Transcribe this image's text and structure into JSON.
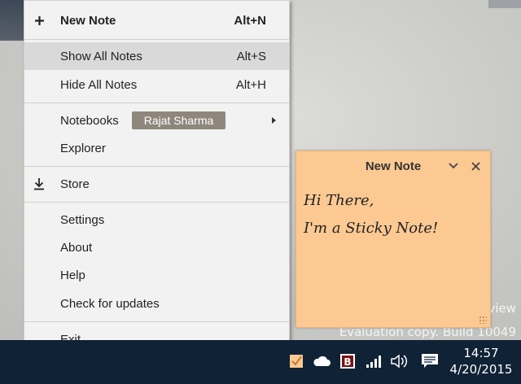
{
  "desktop": {
    "watermark_line1": "view",
    "watermark_line2": "Evaluation copy. Build 10049"
  },
  "menu": {
    "items": [
      {
        "label": "New Note",
        "shortcut": "Alt+N",
        "icon": "plus-icon"
      },
      {
        "label": "Show All Notes",
        "shortcut": "Alt+S"
      },
      {
        "label": "Hide All Notes",
        "shortcut": "Alt+H"
      },
      {
        "label": "Notebooks",
        "badge": "Rajat Sharma",
        "icon": "chevron-right-icon"
      },
      {
        "label": "Explorer"
      },
      {
        "label": "Store",
        "icon": "download-icon"
      },
      {
        "label": "Settings"
      },
      {
        "label": "About"
      },
      {
        "label": "Help"
      },
      {
        "label": "Check for updates"
      },
      {
        "label": "Exit"
      }
    ]
  },
  "sticky_note": {
    "title": "New Note",
    "line1": "Hi There,",
    "line2": "I'm a Sticky Note!",
    "color": "#fcc993"
  },
  "taskbar": {
    "time": "14:57",
    "date": "4/20/2015",
    "tray_icons": [
      "sticky-notes-tray-icon",
      "onedrive-icon",
      "bandizip-icon",
      "network-signal-icon",
      "volume-icon",
      "action-center-icon"
    ]
  }
}
